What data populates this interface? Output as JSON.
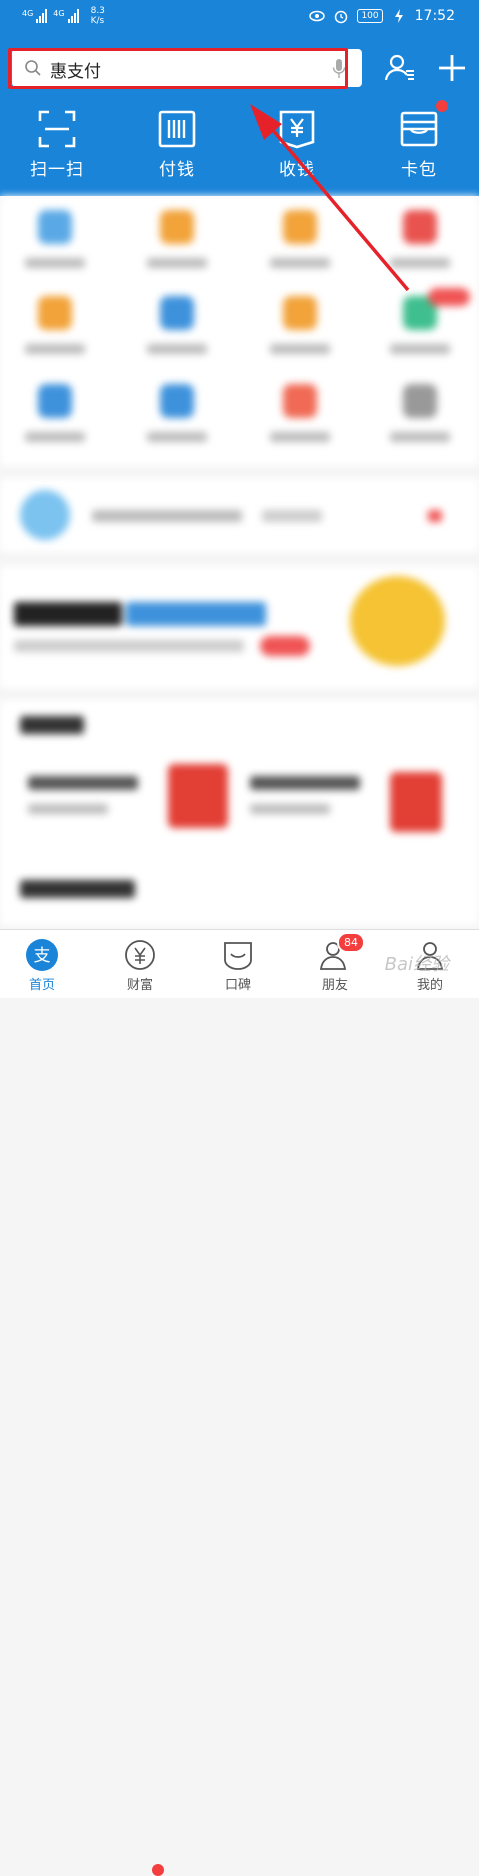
{
  "status_bar": {
    "signal1_label": "4G",
    "signal2_label": "4G",
    "speed_value": "8.3",
    "speed_unit": "K/s",
    "battery": "100",
    "time": "17:52"
  },
  "search": {
    "value": "惠支付"
  },
  "quick_actions": [
    {
      "label": "扫一扫",
      "icon": "scan-icon"
    },
    {
      "label": "付钱",
      "icon": "barcode-icon"
    },
    {
      "label": "收钱",
      "icon": "yuan-icon"
    },
    {
      "label": "卡包",
      "icon": "cardbag-icon"
    }
  ],
  "tabbar": {
    "items": [
      {
        "label": "首页",
        "icon": "alipay-icon"
      },
      {
        "label": "财富",
        "icon": "wealth-icon"
      },
      {
        "label": "口碑",
        "icon": "koubei-icon"
      },
      {
        "label": "朋友",
        "icon": "friends-icon"
      },
      {
        "label": "我的",
        "icon": "me-icon"
      }
    ],
    "friends_badge": "84"
  },
  "watermark": "Bai经验",
  "colors": {
    "brand_blue": "#1a84d9",
    "highlight_red": "#e5222a",
    "badge_red": "#f43d3d"
  }
}
